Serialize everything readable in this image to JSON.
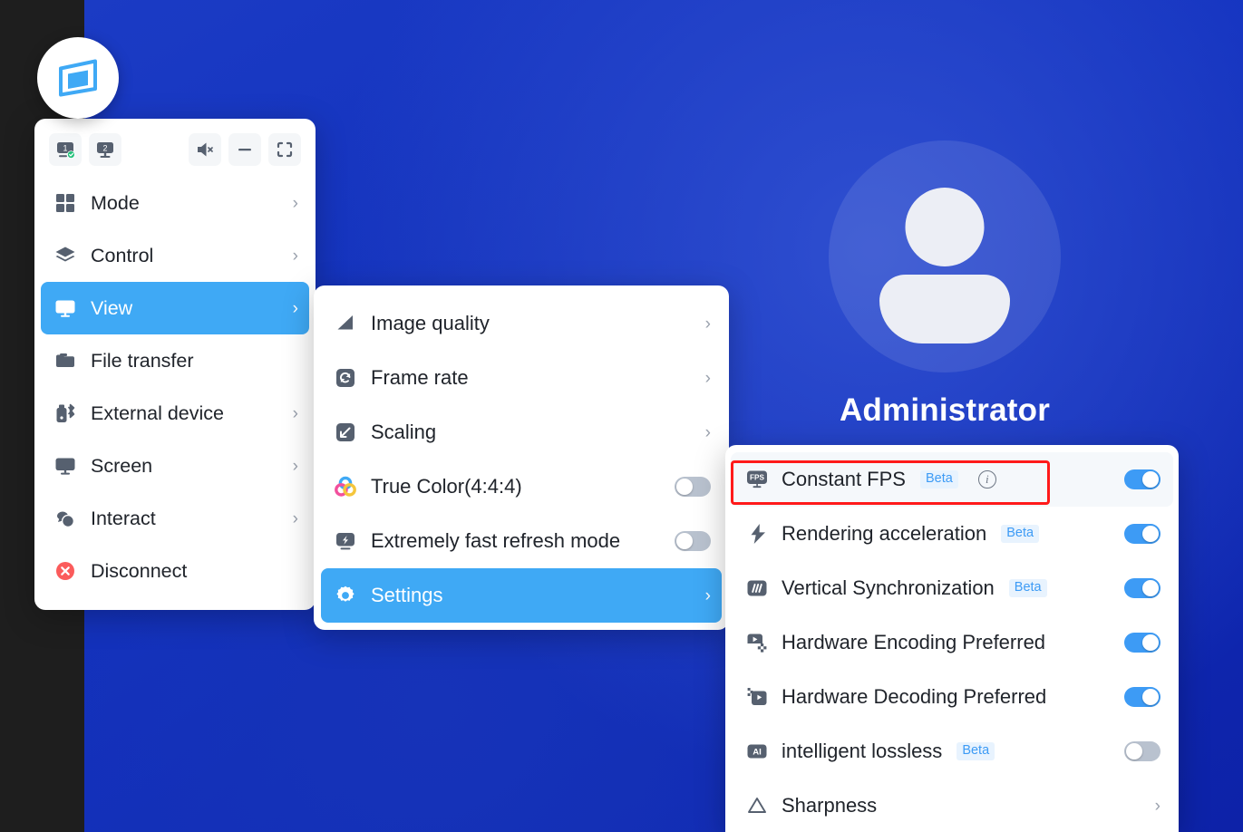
{
  "app": {
    "logo_icon": "remote-screen-logo-icon"
  },
  "remote_desktop": {
    "user_name": "Administrator",
    "avatar_icon": "user-avatar-icon",
    "background_color": "#1130be"
  },
  "toolbar": {
    "buttons": [
      {
        "name": "monitor-1-button",
        "icon": "monitor-icon",
        "label": "1",
        "connected": true
      },
      {
        "name": "monitor-2-button",
        "icon": "monitor-icon",
        "label": "2",
        "connected": false
      },
      {
        "name": "mute-button",
        "icon": "speaker-mute-icon",
        "label": ""
      },
      {
        "name": "minimize-button",
        "icon": "minimize-icon",
        "label": ""
      },
      {
        "name": "fullscreen-button",
        "icon": "fullscreen-icon",
        "label": ""
      }
    ]
  },
  "main_menu": {
    "items": [
      {
        "label": "Mode",
        "icon": "grid-icon",
        "chevron": "›",
        "active": false
      },
      {
        "label": "Control",
        "icon": "layers-icon",
        "chevron": "›",
        "active": false
      },
      {
        "label": "View",
        "icon": "monitor-icon",
        "chevron": "›",
        "active": true
      },
      {
        "label": "File transfer",
        "icon": "folder-icon",
        "chevron": "",
        "active": false
      },
      {
        "label": "External device",
        "icon": "usb-bluetooth-icon",
        "chevron": "›",
        "active": false
      },
      {
        "label": "Screen",
        "icon": "monitor-icon",
        "chevron": "›",
        "active": false
      },
      {
        "label": "Interact",
        "icon": "chat-bubbles-icon",
        "chevron": "›",
        "active": false
      },
      {
        "label": "Disconnect",
        "icon": "disconnect-icon",
        "chevron": "",
        "active": false
      }
    ]
  },
  "view_menu": {
    "items": [
      {
        "label": "Image quality",
        "icon": "image-quality-icon",
        "type": "submenu",
        "chevron": "›",
        "active": false
      },
      {
        "label": "Frame rate",
        "icon": "refresh-icon",
        "type": "submenu",
        "chevron": "›",
        "active": false
      },
      {
        "label": "Scaling",
        "icon": "scaling-arrow-icon",
        "type": "submenu",
        "chevron": "›",
        "active": false
      },
      {
        "label": "True Color(4:4:4)",
        "icon": "color-rings-icon",
        "type": "toggle",
        "toggle_on": false,
        "active": false
      },
      {
        "label": "Extremely fast refresh mode",
        "icon": "fast-refresh-icon",
        "type": "toggle",
        "toggle_on": false,
        "active": false
      },
      {
        "label": "Settings",
        "icon": "gear-icon",
        "type": "submenu",
        "chevron": "›",
        "active": true
      }
    ]
  },
  "settings_menu": {
    "beta_label": "Beta",
    "info_glyph": "i",
    "items": [
      {
        "label": "Constant FPS",
        "icon": "fps-icon",
        "type": "toggle",
        "toggle_on": true,
        "beta": true,
        "info": true,
        "highlight": true
      },
      {
        "label": "Rendering acceleration",
        "icon": "lightning-bolt-icon",
        "type": "toggle",
        "toggle_on": true,
        "beta": true,
        "info": false,
        "highlight": false
      },
      {
        "label": "Vertical Synchronization",
        "icon": "vsync-bars-icon",
        "type": "toggle",
        "toggle_on": true,
        "beta": true,
        "info": false,
        "highlight": false
      },
      {
        "label": "Hardware Encoding Preferred",
        "icon": "hardware-encoding-icon",
        "type": "toggle",
        "toggle_on": true,
        "beta": false,
        "info": false,
        "highlight": false
      },
      {
        "label": "Hardware Decoding Preferred",
        "icon": "hardware-decoding-icon",
        "type": "toggle",
        "toggle_on": true,
        "beta": false,
        "info": false,
        "highlight": false
      },
      {
        "label": "intelligent lossless",
        "icon": "ai-icon",
        "type": "toggle",
        "toggle_on": false,
        "beta": true,
        "info": false,
        "highlight": false
      },
      {
        "label": "Sharpness",
        "icon": "triangle-icon",
        "type": "submenu",
        "chevron": "›",
        "beta": false,
        "info": false,
        "highlight": false
      }
    ]
  },
  "annotation": {
    "highlight_color": "#ff1a1a",
    "target": "Constant FPS"
  },
  "colors": {
    "accent_blue": "#3fa9f5",
    "toggle_on": "#3d9bf5",
    "toggle_off": "#b9c2cf",
    "icon_gray": "#56606f",
    "beta_text": "#3d9bf5",
    "beta_bg": "#e8f3fe",
    "disconnect_red": "#fb5b5b"
  }
}
